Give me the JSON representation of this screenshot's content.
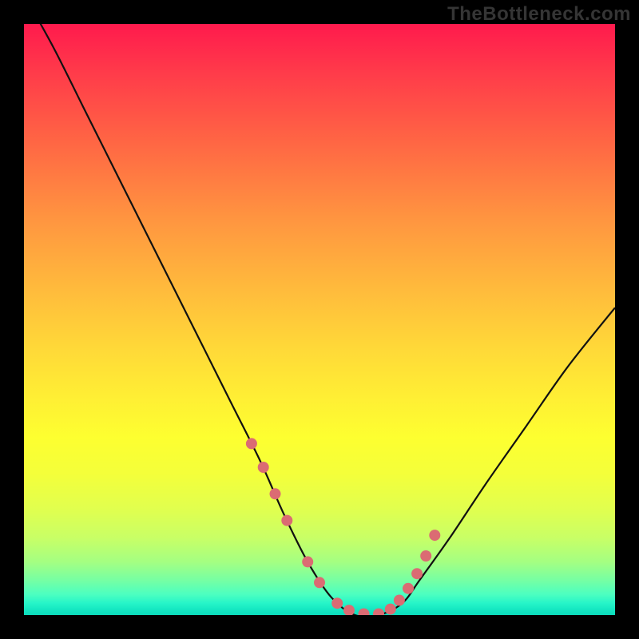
{
  "watermark": "TheBottleneck.com",
  "chart_data": {
    "type": "line",
    "title": "",
    "xlabel": "",
    "ylabel": "",
    "xlim": [
      0,
      100
    ],
    "ylim": [
      0,
      100
    ],
    "background_gradient_metric": "bottleneck_percent",
    "gradient_stops": [
      {
        "pct": 0,
        "color": "#ff1a4d"
      },
      {
        "pct": 50,
        "color": "#ffd938"
      },
      {
        "pct": 100,
        "color": "#0cdcbd"
      }
    ],
    "series": [
      {
        "name": "bottleneck-curve",
        "x": [
          0,
          5,
          10,
          15,
          20,
          25,
          30,
          35,
          40,
          44,
          48,
          52,
          56,
          60,
          64,
          67,
          72,
          78,
          85,
          92,
          100
        ],
        "values": [
          105,
          96,
          86,
          76,
          66,
          56,
          46,
          36,
          26,
          17,
          9,
          3,
          0,
          0,
          2,
          6,
          13,
          22,
          32,
          42,
          52
        ]
      }
    ],
    "marker_points": {
      "name": "highlight-dots",
      "color": "#db6b73",
      "x": [
        38.5,
        40.5,
        42.5,
        44.5,
        48,
        50,
        53,
        55,
        57.5,
        60,
        62,
        63.5,
        65,
        66.5,
        68,
        69.5
      ],
      "values": [
        29,
        25,
        20.5,
        16,
        9,
        5.5,
        2,
        0.8,
        0.2,
        0.2,
        1,
        2.5,
        4.5,
        7,
        10,
        13.5
      ]
    }
  }
}
